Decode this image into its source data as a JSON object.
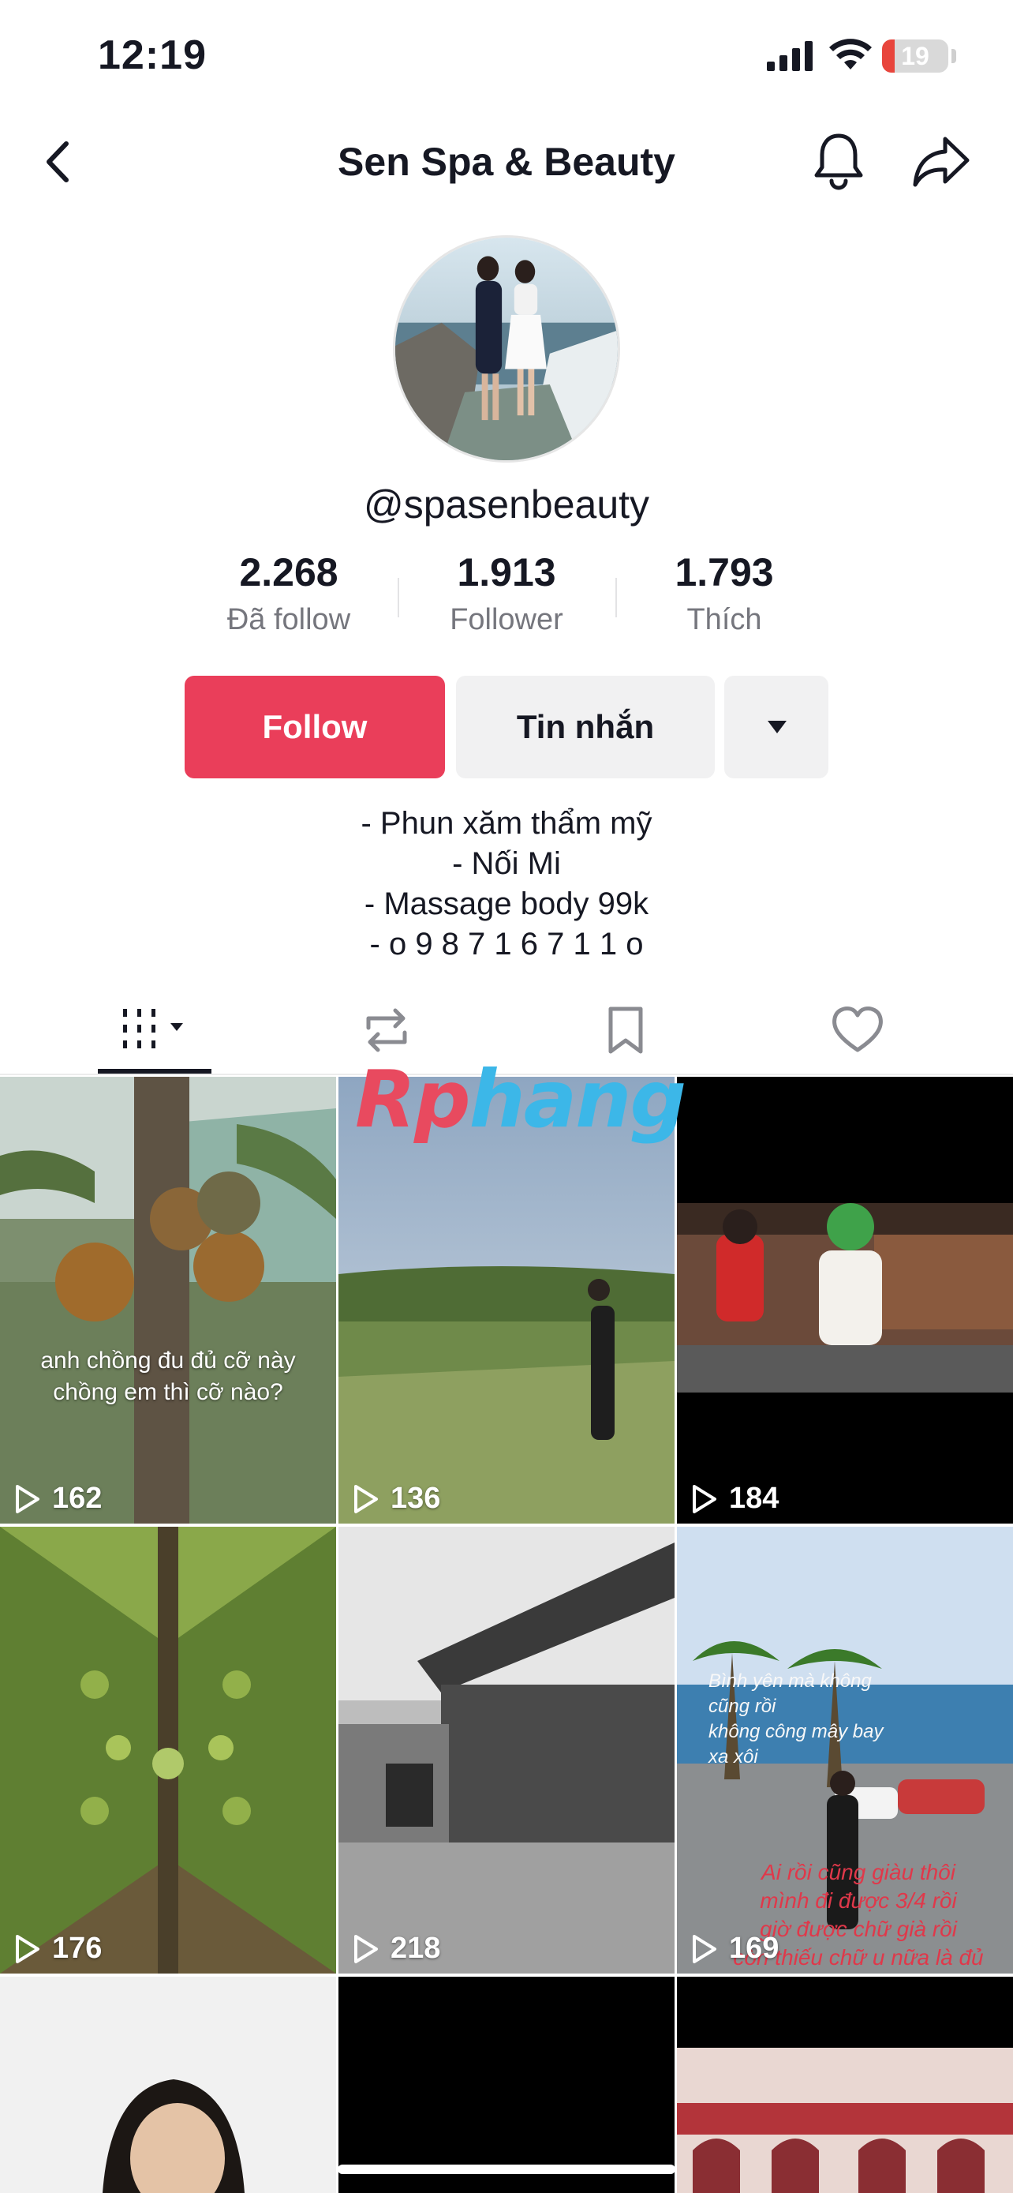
{
  "status_bar": {
    "time": "12:19",
    "battery_level": "19",
    "battery_fraction": 0.19
  },
  "header": {
    "title": "Sen Spa & Beauty",
    "back_icon": "chevron-left-icon",
    "bell_icon": "bell-icon",
    "share_icon": "share-icon"
  },
  "profile": {
    "username": "@spasenbeauty",
    "stats": [
      {
        "value": "2.268",
        "label": "Đã follow"
      },
      {
        "value": "1.913",
        "label": "Follower"
      },
      {
        "value": "1.793",
        "label": "Thích"
      }
    ],
    "buttons": {
      "follow": "Follow",
      "message": "Tin nhắn"
    },
    "bio": [
      "- Phun xăm thẩm mỹ",
      "- Nối Mi",
      "- Massage body 99k",
      "- o 9 8 7 1 6 7 1 1 o"
    ]
  },
  "tabs": [
    {
      "name": "videos",
      "icon": "grid-icon",
      "active": true
    },
    {
      "name": "reposts",
      "icon": "repost-icon",
      "active": false
    },
    {
      "name": "favorites",
      "icon": "bookmark-icon",
      "active": false
    },
    {
      "name": "liked",
      "icon": "heart-icon",
      "active": false
    }
  ],
  "watermark": {
    "part1": "Rp",
    "part2": "hang"
  },
  "videos": [
    {
      "views": "162",
      "caption": "anh chồng đu đủ cỡ này\nchồng em thì cỡ nào?"
    },
    {
      "views": "136",
      "caption": ""
    },
    {
      "views": "184",
      "caption": ""
    },
    {
      "views": "176",
      "caption": ""
    },
    {
      "views": "218",
      "caption": ""
    },
    {
      "views": "169",
      "caption": "Ai rồi cũng giàu thôi\nmình đi được 3/4 rồi\ngiờ được chữ già rồi\ncòn thiếu chữ u nữa là đủ",
      "caption_top": "Bình yên mà không cũng rồi\nkhông công mây bay xa xôi"
    },
    {
      "views": "",
      "caption": ""
    },
    {
      "views": "",
      "caption": ""
    },
    {
      "views": "",
      "caption": ""
    }
  ],
  "colors": {
    "accent": "#ea3e5a",
    "text": "#161823",
    "muted": "#75767d",
    "button_bg": "#f1f1f2"
  }
}
